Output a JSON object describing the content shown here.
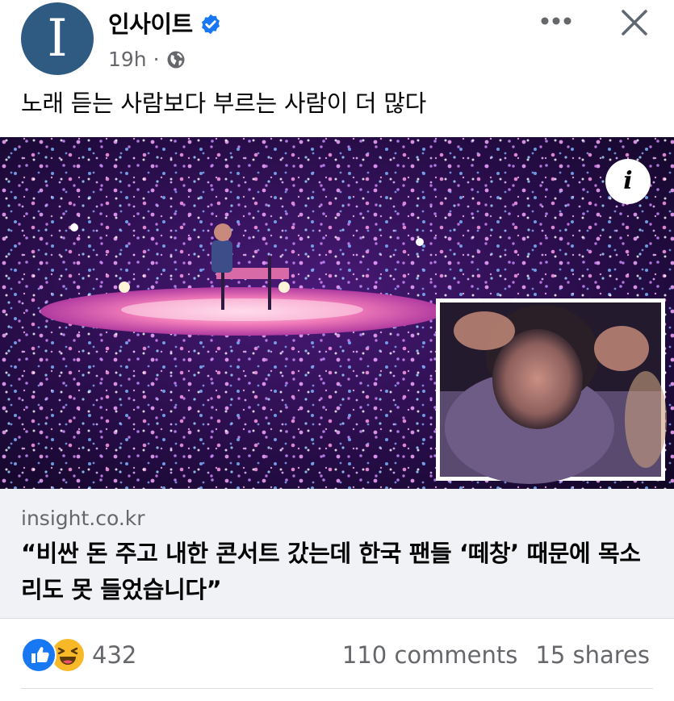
{
  "post": {
    "page_name": "인사이트",
    "avatar_letter": "I",
    "time": "19h",
    "separator": "·",
    "text": "노래 듣는 사람보다 부르는 사람이 더 많다"
  },
  "icons": {
    "verified": "verified-badge-icon",
    "audience": "globe-icon",
    "more": "more-options-icon",
    "close": "close-icon",
    "info": "info-icon",
    "like": "like-reaction-icon",
    "haha": "haha-reaction-icon"
  },
  "media": {
    "info_glyph": "i"
  },
  "link_card": {
    "domain": "insight.co.kr",
    "headline": "“비싼 돈 주고 내한 콘서트 갔는데 한국 팬들 ‘떼창’ 때문에 목소리도 못 들었습니다”"
  },
  "stats": {
    "reactions_count": "432",
    "comments": "110 comments",
    "shares": "15 shares"
  },
  "colors": {
    "avatar_bg": "#2f5b82",
    "verified": "#1877f2",
    "secondary_text": "#65676b",
    "card_bg": "#f0f2f5",
    "like": "#1877f2",
    "haha": "#f7b928"
  }
}
